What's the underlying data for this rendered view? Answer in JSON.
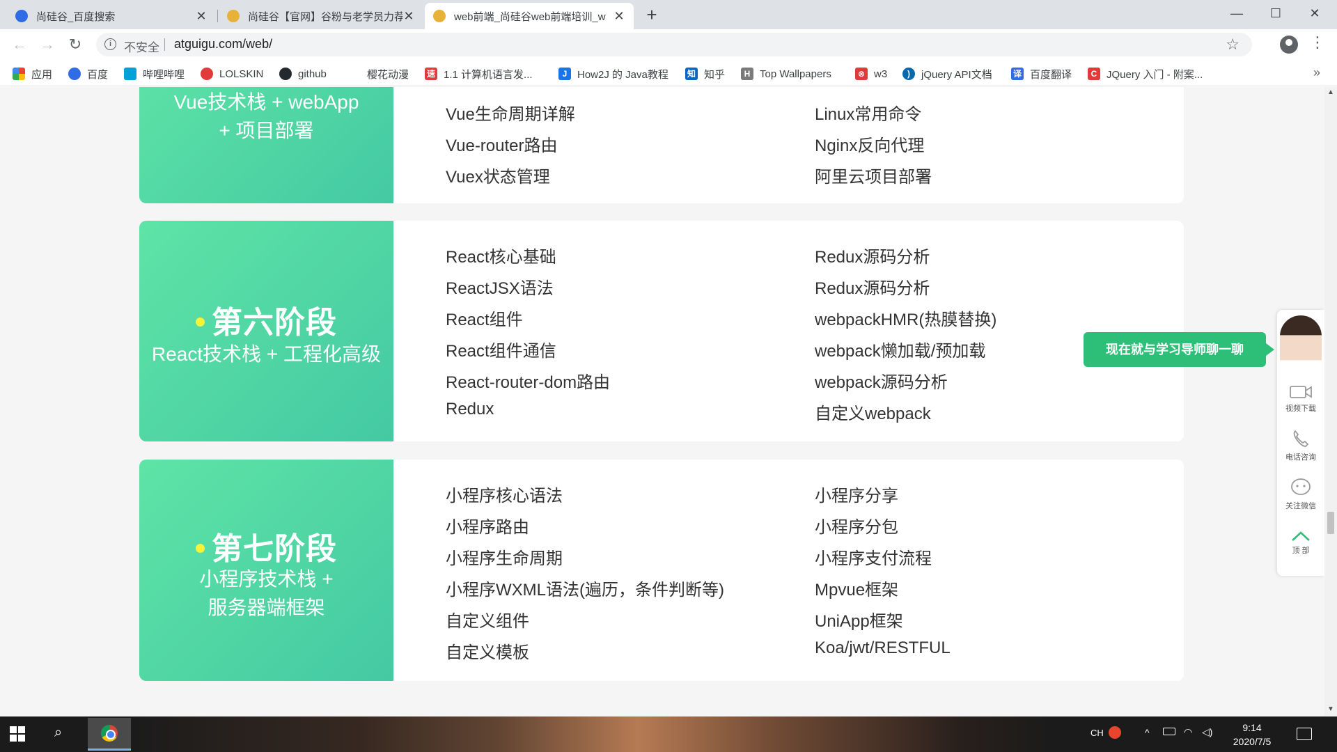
{
  "browser": {
    "tabs": [
      {
        "title": "尚硅谷_百度搜索",
        "favicon_color": "#2f6ce5"
      },
      {
        "title": "尚硅谷【官网】谷粉与老学员力荐",
        "favicon_color": "#e8b23a"
      },
      {
        "title": "web前端_尚硅谷web前端培训_w",
        "favicon_color": "#e8b23a"
      }
    ],
    "window_controls": {
      "minimize": "—",
      "maximize": "☐",
      "close": "✕"
    },
    "address": {
      "security_label": "不安全",
      "url": "atguigu.com/web/"
    },
    "bookmarks": [
      {
        "label": "应用",
        "icon": "apps-grid-icon",
        "color": "#ea4335"
      },
      {
        "label": "百度",
        "icon": "baidu-paw-icon",
        "color": "#2f6ce5"
      },
      {
        "label": "哔哩哔哩",
        "icon": "bilibili-tv-icon",
        "color": "#00a1d6"
      },
      {
        "label": "LOLSKIN",
        "icon": "lolskin-icon",
        "color": "#e03a3a"
      },
      {
        "label": "github",
        "icon": "github-icon",
        "color": "#24292e"
      },
      {
        "label": "樱花动漫",
        "icon": "sakura-icon",
        "color": "#ffffff"
      },
      {
        "label": "1.1 计算机语言发...",
        "icon": "speed-icon",
        "color": "#e03a3a"
      },
      {
        "label": "How2J 的 Java教程",
        "icon": "how2j-icon",
        "color": "#1a73e8"
      },
      {
        "label": "知乎",
        "icon": "zhihu-icon",
        "color": "#0a66c2"
      },
      {
        "label": "Top Wallpapers",
        "icon": "wallpaper-icon",
        "color": "#7a7a7a"
      },
      {
        "label": "w3",
        "icon": "w3-icon",
        "color": "#e03a3a"
      },
      {
        "label": "jQuery API文档",
        "icon": "jquery-icon",
        "color": "#0769ad"
      },
      {
        "label": "百度翻译",
        "icon": "translate-icon",
        "color": "#2f6ce5"
      },
      {
        "label": "JQuery 入门 - 附案...",
        "icon": "csdn-icon",
        "color": "#e03a3a"
      }
    ],
    "bookmarks_more": "»"
  },
  "stage5": {
    "subtitle_line1": "Vue技术栈 + webApp",
    "subtitle_line2": "+ 项目部署",
    "left_topics": [
      "Vue生命周期详解",
      "Vue-router路由",
      "Vuex状态管理"
    ],
    "right_topics": [
      "Linux常用命令",
      "Nginx反向代理",
      "阿里云项目部署"
    ]
  },
  "stage6": {
    "title": "第六阶段",
    "subtitle_line1": "React技术栈 + 工程化高级",
    "left_topics": [
      "React核心基础",
      "ReactJSX语法",
      "React组件",
      "React组件通信",
      "React-router-dom路由",
      "Redux"
    ],
    "right_topics": [
      "Redux源码分析",
      "Redux源码分析",
      "webpackHMR(热膜替换)",
      "webpack懒加载/预加载",
      "webpack源码分析",
      "自定义webpack"
    ]
  },
  "stage7": {
    "title": "第七阶段",
    "subtitle_line1": "小程序技术栈 +",
    "subtitle_line2": "服务器端框架",
    "left_topics": [
      "小程序核心语法",
      "小程序路由",
      "小程序生命周期",
      "小程序WXML语法(遍历，条件判断等)",
      "自定义组件",
      "自定义模板"
    ],
    "right_topics": [
      "小程序分享",
      "小程序分包",
      "小程序支付流程",
      "Mpvue框架",
      "UniApp框架",
      "Koa/jwt/RESTFUL"
    ]
  },
  "service_bar": {
    "chat_prompt": "现在就与学习导师聊一聊",
    "items": [
      {
        "label": "视频下载",
        "icon": "video-camera-icon"
      },
      {
        "label": "电话咨询",
        "icon": "phone-icon"
      },
      {
        "label": "关注微信",
        "icon": "wechat-icon"
      },
      {
        "label": "顶 部",
        "icon": "chevron-up-icon"
      }
    ]
  },
  "colors": {
    "accent_green_start": "#5ee4a6",
    "accent_green_end": "#44c9a3",
    "bullet_yellow": "#f7f23a",
    "chat_green": "#2dbf77"
  },
  "taskbar": {
    "ime": "CH",
    "time": "9:14",
    "date": "2020/7/5"
  }
}
